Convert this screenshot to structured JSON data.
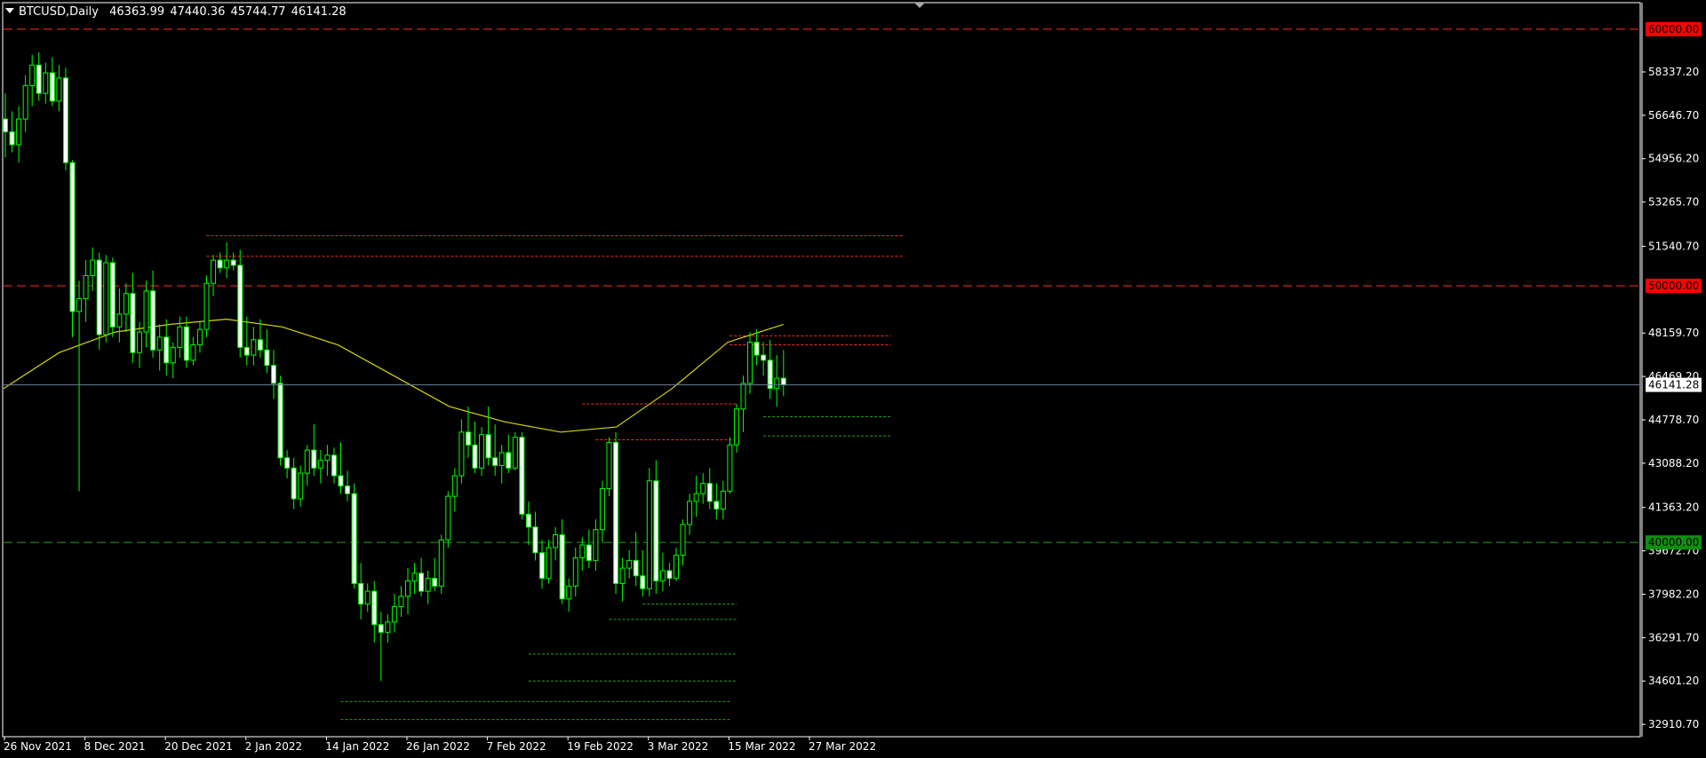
{
  "window": {
    "symbol": "BTCUSD",
    "timeframe": "Daily",
    "ohlc": {
      "open": "46363.99",
      "high": "47440.36",
      "low": "45744.77",
      "close": "46141.28"
    }
  },
  "colors": {
    "background": "#000000",
    "frame": "#ffffff",
    "bull_candle": "#00ff00",
    "bear_candle_body": "#ffffff",
    "moving_average": "#d6d600",
    "resistance_line": "#ff2a2a",
    "support_line": "#1fa31f",
    "current_price_line": "#6b7f99",
    "axis_text": "#ffffff"
  },
  "chart_data": {
    "type": "candlestick",
    "symbol": "BTCUSD",
    "timeframe": "Daily",
    "y_ticks": [
      "58337.20",
      "56646.70",
      "54956.20",
      "53265.70",
      "51540.70",
      "48159.70",
      "46469.20",
      "44778.70",
      "43088.20",
      "41363.20",
      "39672.70",
      "37982.20",
      "36291.70",
      "34601.20",
      "32910.70"
    ],
    "x_ticks": [
      "26 Nov 2021",
      "8 Dec 2021",
      "20 Dec 2021",
      "2 Jan 2022",
      "14 Jan 2022",
      "26 Jan 2022",
      "7 Feb 2022",
      "19 Feb 2022",
      "3 Mar 2022",
      "15 Mar 2022",
      "27 Mar 2022"
    ],
    "ylim": [
      32500,
      61000
    ],
    "grid": false,
    "price_levels": [
      {
        "label": "60000.00",
        "value": 60000,
        "kind": "resistance"
      },
      {
        "label": "50000.00",
        "value": 50000,
        "kind": "resistance"
      },
      {
        "label": "40000.00",
        "value": 40000,
        "kind": "support"
      }
    ],
    "current_price": {
      "label": "46141.28",
      "value": 46141.28
    },
    "candles_approx": [
      [
        56500,
        57500,
        55000,
        56000
      ],
      [
        56000,
        56800,
        55200,
        55500
      ],
      [
        55500,
        57000,
        54800,
        56500
      ],
      [
        56500,
        58200,
        56000,
        57800
      ],
      [
        57800,
        59000,
        57000,
        58600
      ],
      [
        58600,
        59100,
        57200,
        57500
      ],
      [
        57500,
        58700,
        57100,
        58300
      ],
      [
        58300,
        58900,
        57000,
        57200
      ],
      [
        57200,
        58600,
        56800,
        58100
      ],
      [
        58100,
        58500,
        54500,
        54800
      ],
      [
        54800,
        54900,
        48000,
        49000
      ],
      [
        49000,
        50200,
        42000,
        49500
      ],
      [
        49500,
        51000,
        48600,
        50400
      ],
      [
        50400,
        51500,
        49800,
        51000
      ],
      [
        51000,
        51300,
        47500,
        48100
      ],
      [
        48100,
        51200,
        47800,
        50900
      ],
      [
        50900,
        51100,
        48000,
        48400
      ],
      [
        48400,
        49900,
        47800,
        48900
      ],
      [
        48900,
        50100,
        48200,
        49700
      ],
      [
        49700,
        50500,
        47000,
        47400
      ],
      [
        47400,
        48600,
        46800,
        48200
      ],
      [
        48200,
        50200,
        47600,
        49800
      ],
      [
        49800,
        50600,
        47200,
        47500
      ],
      [
        47500,
        48500,
        46700,
        48000
      ],
      [
        48000,
        48700,
        46500,
        47000
      ],
      [
        47000,
        47800,
        46400,
        47600
      ],
      [
        47600,
        48800,
        47200,
        48400
      ],
      [
        48400,
        48800,
        46800,
        47100
      ],
      [
        47100,
        48000,
        46900,
        47700
      ],
      [
        47700,
        48600,
        47400,
        48300
      ],
      [
        48300,
        50400,
        48000,
        50100
      ],
      [
        50100,
        51200,
        49600,
        51000
      ],
      [
        51000,
        51300,
        50500,
        50700
      ],
      [
        50700,
        51700,
        50300,
        51000
      ],
      [
        51000,
        51300,
        50600,
        50800
      ],
      [
        50800,
        51400,
        47200,
        47600
      ],
      [
        47600,
        48800,
        46900,
        47300
      ],
      [
        47300,
        48400,
        46900,
        47900
      ],
      [
        47900,
        48700,
        47200,
        47500
      ],
      [
        47500,
        48300,
        46600,
        46900
      ],
      [
        46900,
        47500,
        45600,
        46200
      ],
      [
        46200,
        46500,
        43000,
        43300
      ],
      [
        43300,
        43600,
        42500,
        42900
      ],
      [
        42900,
        43300,
        41300,
        41700
      ],
      [
        41700,
        43000,
        41400,
        42700
      ],
      [
        42700,
        43800,
        42200,
        43600
      ],
      [
        43600,
        44600,
        42600,
        42900
      ],
      [
        42900,
        43600,
        42300,
        43200
      ],
      [
        43200,
        43800,
        42600,
        43400
      ],
      [
        43400,
        43700,
        42300,
        42600
      ],
      [
        42600,
        43900,
        41900,
        42200
      ],
      [
        42200,
        42800,
        41600,
        41900
      ],
      [
        41900,
        42300,
        38200,
        38400
      ],
      [
        38400,
        39200,
        37000,
        37600
      ],
      [
        37600,
        38400,
        37300,
        38100
      ],
      [
        38100,
        38500,
        36100,
        36800
      ],
      [
        36800,
        37300,
        34600,
        36500
      ],
      [
        36500,
        37200,
        36100,
        36900
      ],
      [
        36900,
        38000,
        36500,
        37500
      ],
      [
        37500,
        38300,
        37100,
        37900
      ],
      [
        37900,
        39000,
        37200,
        38500
      ],
      [
        38500,
        39200,
        38000,
        38800
      ],
      [
        38800,
        39400,
        37900,
        38100
      ],
      [
        38100,
        38900,
        37600,
        38600
      ],
      [
        38600,
        39400,
        38100,
        38300
      ],
      [
        38300,
        40300,
        38000,
        40100
      ],
      [
        40100,
        42000,
        39800,
        41800
      ],
      [
        41800,
        42900,
        41200,
        42600
      ],
      [
        42600,
        44800,
        42300,
        44300
      ],
      [
        44300,
        45300,
        43300,
        43800
      ],
      [
        43800,
        44700,
        42700,
        42900
      ],
      [
        42900,
        44500,
        42600,
        44200
      ],
      [
        44200,
        45300,
        43000,
        43300
      ],
      [
        43300,
        44600,
        42600,
        43000
      ],
      [
        43000,
        43800,
        42300,
        43500
      ],
      [
        43500,
        44200,
        42700,
        42900
      ],
      [
        42900,
        44300,
        42800,
        44100
      ],
      [
        44100,
        44300,
        40900,
        41100
      ],
      [
        41100,
        41600,
        39900,
        40600
      ],
      [
        40600,
        41200,
        39300,
        39600
      ],
      [
        39600,
        40100,
        38200,
        38600
      ],
      [
        38600,
        40100,
        38400,
        39800
      ],
      [
        39800,
        40600,
        39300,
        40300
      ],
      [
        40300,
        40900,
        37600,
        37800
      ],
      [
        37800,
        38600,
        37300,
        38300
      ],
      [
        38300,
        39800,
        37900,
        39400
      ],
      [
        39400,
        40200,
        38900,
        39900
      ],
      [
        39900,
        40500,
        39000,
        39300
      ],
      [
        39300,
        40900,
        38900,
        40500
      ],
      [
        40500,
        42400,
        40000,
        42100
      ],
      [
        42100,
        44100,
        41800,
        43900
      ],
      [
        43900,
        44300,
        38000,
        38400
      ],
      [
        38400,
        39400,
        37700,
        39000
      ],
      [
        39000,
        39700,
        38600,
        39300
      ],
      [
        39300,
        40400,
        38300,
        38700
      ],
      [
        38700,
        39700,
        37900,
        38200
      ],
      [
        38200,
        42900,
        37900,
        42400
      ],
      [
        42400,
        43200,
        38000,
        38500
      ],
      [
        38500,
        39600,
        38100,
        38900
      ],
      [
        38900,
        39200,
        38300,
        38600
      ],
      [
        38600,
        39800,
        38500,
        39500
      ],
      [
        39500,
        40900,
        39100,
        40700
      ],
      [
        40700,
        41900,
        40300,
        41600
      ],
      [
        41600,
        42600,
        41000,
        41900
      ],
      [
        41900,
        42700,
        41500,
        42300
      ],
      [
        42300,
        42900,
        41300,
        41600
      ],
      [
        41600,
        42300,
        40900,
        41300
      ],
      [
        41300,
        42400,
        40900,
        42000
      ],
      [
        42000,
        44100,
        41900,
        43800
      ],
      [
        43800,
        45400,
        43500,
        45200
      ],
      [
        45200,
        46500,
        44300,
        46200
      ],
      [
        46200,
        48200,
        45800,
        47800
      ],
      [
        47800,
        48300,
        46900,
        47300
      ],
      [
        47300,
        47800,
        46500,
        47100
      ],
      [
        47100,
        47900,
        45600,
        46000
      ],
      [
        46000,
        47300,
        45300,
        46400
      ],
      [
        46400,
        47500,
        45700,
        46141.28
      ]
    ],
    "moving_average_approx": [
      46000,
      47400,
      48200,
      48500,
      48700,
      48400,
      47700,
      46500,
      45300,
      44700,
      44300,
      44500,
      46000,
      47800,
      48500
    ],
    "drawn_segments": [
      {
        "from_bar": 30,
        "to_bar": 134,
        "value": 51950,
        "kind": "resistance"
      },
      {
        "from_bar": 30,
        "to_bar": 134,
        "value": 51150,
        "kind": "resistance"
      },
      {
        "from_bar": 108,
        "to_bar": 132,
        "value": 48050,
        "kind": "resistance"
      },
      {
        "from_bar": 108,
        "to_bar": 132,
        "value": 47700,
        "kind": "resistance"
      },
      {
        "from_bar": 86,
        "to_bar": 109,
        "value": 45400,
        "kind": "resistance"
      },
      {
        "from_bar": 88,
        "to_bar": 109,
        "value": 44000,
        "kind": "resistance"
      },
      {
        "from_bar": 113,
        "to_bar": 132,
        "value": 44900,
        "kind": "support"
      },
      {
        "from_bar": 113,
        "to_bar": 132,
        "value": 44150,
        "kind": "support"
      },
      {
        "from_bar": 95,
        "to_bar": 109,
        "value": 37600,
        "kind": "support"
      },
      {
        "from_bar": 90,
        "to_bar": 109,
        "value": 37000,
        "kind": "support"
      },
      {
        "from_bar": 78,
        "to_bar": 109,
        "value": 35650,
        "kind": "support"
      },
      {
        "from_bar": 78,
        "to_bar": 109,
        "value": 34600,
        "kind": "support"
      },
      {
        "from_bar": 50,
        "to_bar": 108,
        "value": 33800,
        "kind": "support"
      },
      {
        "from_bar": 50,
        "to_bar": 108,
        "value": 33100,
        "kind": "support"
      }
    ]
  }
}
